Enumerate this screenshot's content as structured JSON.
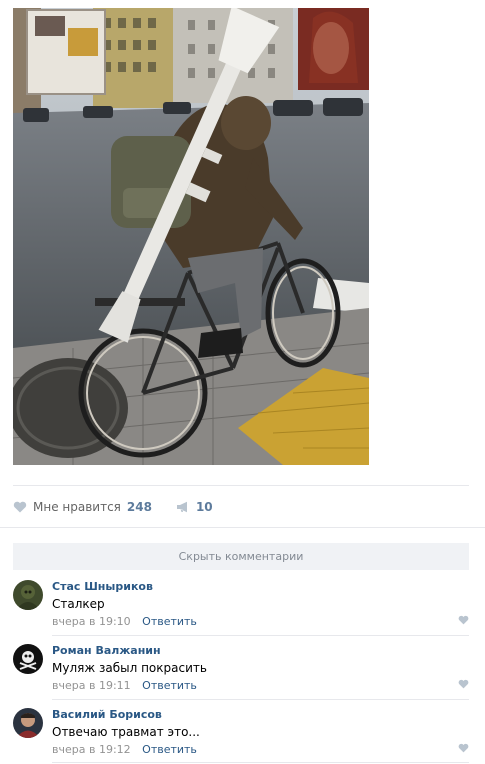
{
  "post": {
    "photo_icon": "photo-man-bicycle-rpg",
    "likes_label": "Мне нравится",
    "likes_count": "248",
    "shares_count": "10",
    "hide_comments_label": "Скрыть комментарии"
  },
  "comments": [
    {
      "author": "Стас Шныриков",
      "text": "Сталкер",
      "time": "вчера в 19:10",
      "reply": "Ответить"
    },
    {
      "author": "Роман Валжанин",
      "text": "Муляж забыл покрасить",
      "time": "вчера в 19:11",
      "reply": "Ответить"
    },
    {
      "author": "Василий Борисов",
      "text": "Отвечаю травмат это...",
      "time": "вчера в 19:12",
      "reply": "Ответить"
    }
  ],
  "colors": {
    "link": "#2a5885",
    "counter": "#5d7b9c",
    "muted": "#939393",
    "heart": "#b9c4cf",
    "bar": "#f0f2f5"
  }
}
